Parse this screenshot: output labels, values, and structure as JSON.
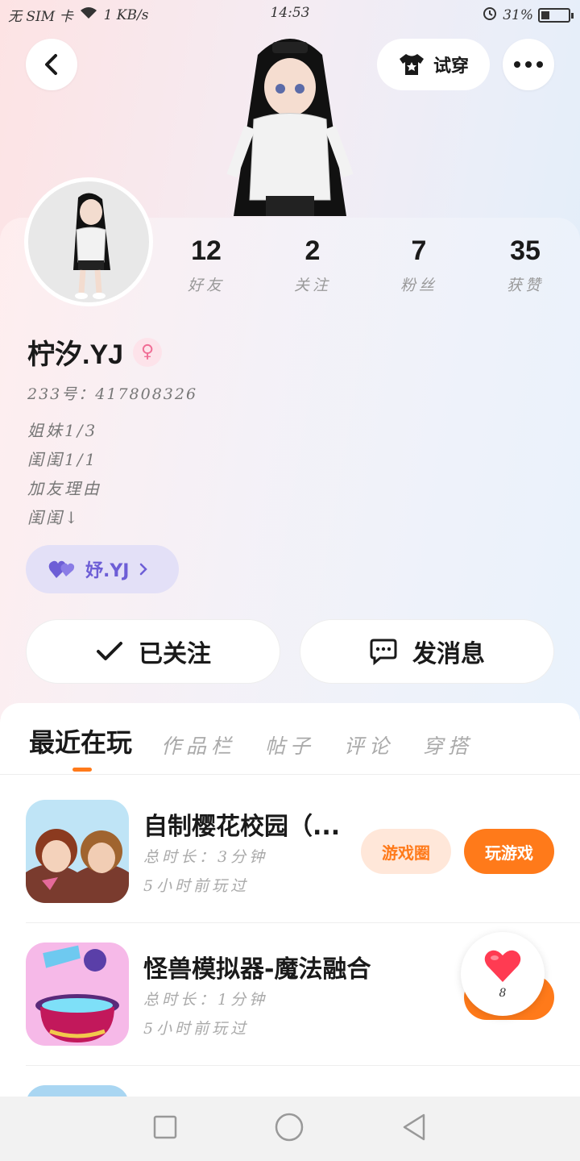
{
  "status_bar": {
    "carrier": "无 SIM 卡",
    "speed": "1 KB/s",
    "time": "14:53",
    "battery": "31%",
    "battery_level": 0.31
  },
  "header": {
    "tryon_label": "试穿"
  },
  "stats": [
    {
      "value": "12",
      "label": "好友"
    },
    {
      "value": "2",
      "label": "关注"
    },
    {
      "value": "7",
      "label": "粉丝"
    },
    {
      "value": "35",
      "label": "获赞"
    }
  ],
  "profile": {
    "name": "柠汐.YJ",
    "gender_symbol": "♀",
    "uid": "233号：417808326",
    "bio": [
      "姐妹1/3",
      "闺闺1/1",
      "加友理由",
      "闺闺↓"
    ],
    "cp_name": "妤.YJ"
  },
  "actions": {
    "followed_label": "已关注",
    "message_label": "发消息"
  },
  "tabs": [
    "最近在玩",
    "作品栏",
    "帖子",
    "评论",
    "穿搭"
  ],
  "games": [
    {
      "title": "自制樱花校园（...",
      "duration": "总时长：3分钟",
      "last_played": "5小时前玩过",
      "circle_label": "游戏圈",
      "play_label": "玩游戏"
    },
    {
      "title": "怪兽模拟器-魔法融合",
      "duration": "总时长：1分钟",
      "last_played": "5小时前玩过"
    }
  ],
  "like_float": {
    "count": "8"
  },
  "colors": {
    "accent": "#ff7a1a",
    "cp_purple": "#6d5ed6",
    "gender_pink": "#f06d95"
  }
}
